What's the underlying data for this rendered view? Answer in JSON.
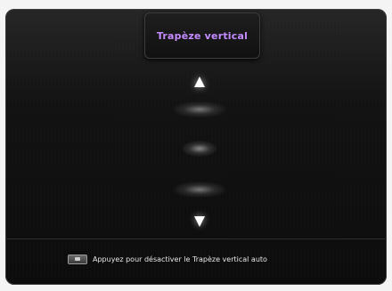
{
  "menu": {
    "title": "Trapèze vertical"
  },
  "controls": {
    "up_icon": "arrow-up-icon",
    "down_icon": "arrow-down-icon"
  },
  "footer": {
    "key_icon": "auto-keystone-key-icon",
    "hint": "Appuyez pour désactiver le Trapèze vertical auto"
  },
  "colors": {
    "title": "#c58cff",
    "background": "#111111",
    "text": "#e8e8e8"
  }
}
